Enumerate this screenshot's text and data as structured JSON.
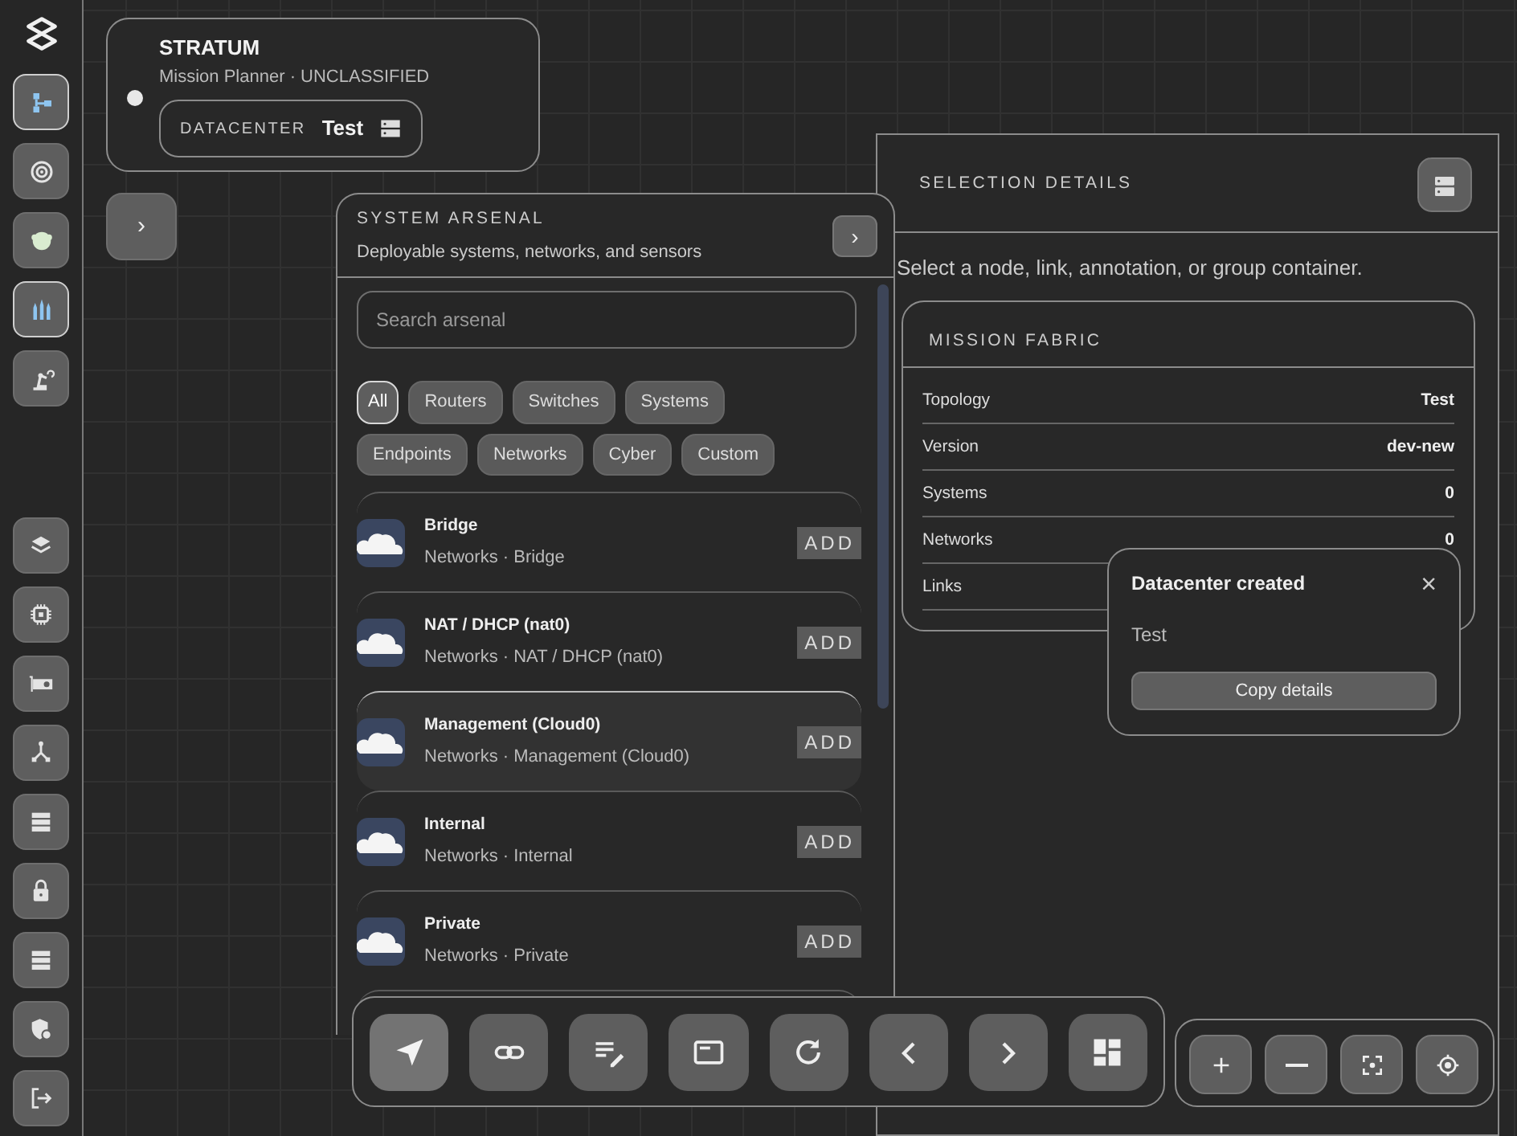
{
  "sidebar": {
    "top_items": [
      {
        "selected": true
      },
      {
        "selected": false
      },
      {
        "selected": false
      },
      {
        "selected": true
      },
      {
        "selected": false
      }
    ],
    "bottom_items": [
      {
        "selected": false
      },
      {
        "selected": false
      },
      {
        "selected": false
      },
      {
        "selected": false
      },
      {
        "selected": false
      },
      {
        "selected": false
      },
      {
        "selected": false
      },
      {
        "selected": false
      },
      {
        "selected": false
      }
    ]
  },
  "header": {
    "title": "STRATUM",
    "subtitle": "Mission Planner · UNCLASSIFIED",
    "status_online": true,
    "datacenter_label": "DATACENTER",
    "datacenter_value": "Test"
  },
  "expand_button": {
    "label": "›"
  },
  "arsenal": {
    "title": "SYSTEM ARSENAL",
    "subtitle": "Deployable systems, networks, and sensors",
    "collapse_label": "›",
    "search": {
      "placeholder": "Search arsenal"
    },
    "filters": [
      {
        "label": "All",
        "selected": true
      },
      {
        "label": "Routers",
        "selected": false
      },
      {
        "label": "Switches",
        "selected": false
      },
      {
        "label": "Systems",
        "selected": false
      },
      {
        "label": "Endpoints",
        "selected": false
      },
      {
        "label": "Networks",
        "selected": false
      },
      {
        "label": "Cyber",
        "selected": false
      },
      {
        "label": "Custom",
        "selected": false
      }
    ],
    "items": [
      {
        "name": "Bridge",
        "detail": "Networks · Bridge",
        "action": "ADD",
        "highlighted": false
      },
      {
        "name": "NAT / DHCP (nat0)",
        "detail": "Networks · NAT / DHCP (nat0)",
        "action": "ADD",
        "highlighted": false
      },
      {
        "name": "Management (Cloud0)",
        "detail": "Networks · Management (Cloud0)",
        "action": "ADD",
        "highlighted": true
      },
      {
        "name": "Internal",
        "detail": "Networks · Internal",
        "action": "ADD",
        "highlighted": false
      },
      {
        "name": "Private",
        "detail": "Networks · Private",
        "action": "ADD",
        "highlighted": false
      }
    ]
  },
  "selection_details": {
    "title": "SELECTION DETAILS",
    "hint": "Select a node, link, annotation, or group container.",
    "card": {
      "title": "MISSION FABRIC",
      "rows": [
        {
          "label": "Topology",
          "value": "Test"
        },
        {
          "label": "Version",
          "value": "dev-new"
        },
        {
          "label": "Systems",
          "value": "0"
        },
        {
          "label": "Networks",
          "value": "0"
        },
        {
          "label": "Links"
        }
      ]
    }
  },
  "toast": {
    "title": "Datacenter created",
    "close": "×",
    "body": "Test",
    "button": "Copy details"
  },
  "toolbar": [
    {
      "selected": true
    },
    {
      "selected": false
    },
    {
      "selected": false
    },
    {
      "selected": false
    },
    {
      "selected": false
    },
    {
      "selected": false
    },
    {
      "selected": false
    },
    {
      "selected": false
    }
  ],
  "zoom_controls": [
    {
      "selected": false
    },
    {
      "selected": false
    },
    {
      "selected": false
    },
    {
      "selected": false
    }
  ]
}
